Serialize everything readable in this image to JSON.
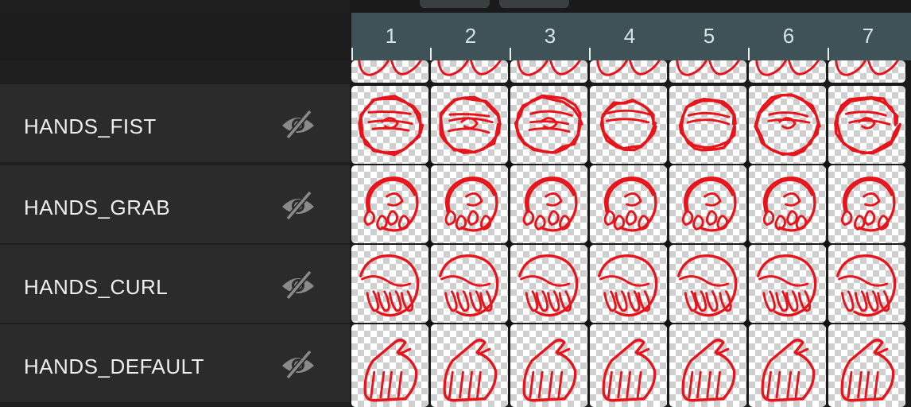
{
  "layers": [
    {
      "name": "HANDS_FIST",
      "visible": false,
      "icon": "eye-hidden-icon"
    },
    {
      "name": "HANDS_GRAB",
      "visible": false,
      "icon": "eye-hidden-icon"
    },
    {
      "name": "HANDS_CURL",
      "visible": false,
      "icon": "eye-hidden-icon"
    },
    {
      "name": "HANDS_DEFAULT",
      "visible": false,
      "icon": "eye-hidden-icon"
    }
  ],
  "frames": [
    "1",
    "2",
    "3",
    "4",
    "5",
    "6",
    "7"
  ],
  "colors": {
    "drawing_stroke": "#e8141c",
    "frame_header": "#3e5257",
    "layer_row": "#2b2b2b"
  }
}
